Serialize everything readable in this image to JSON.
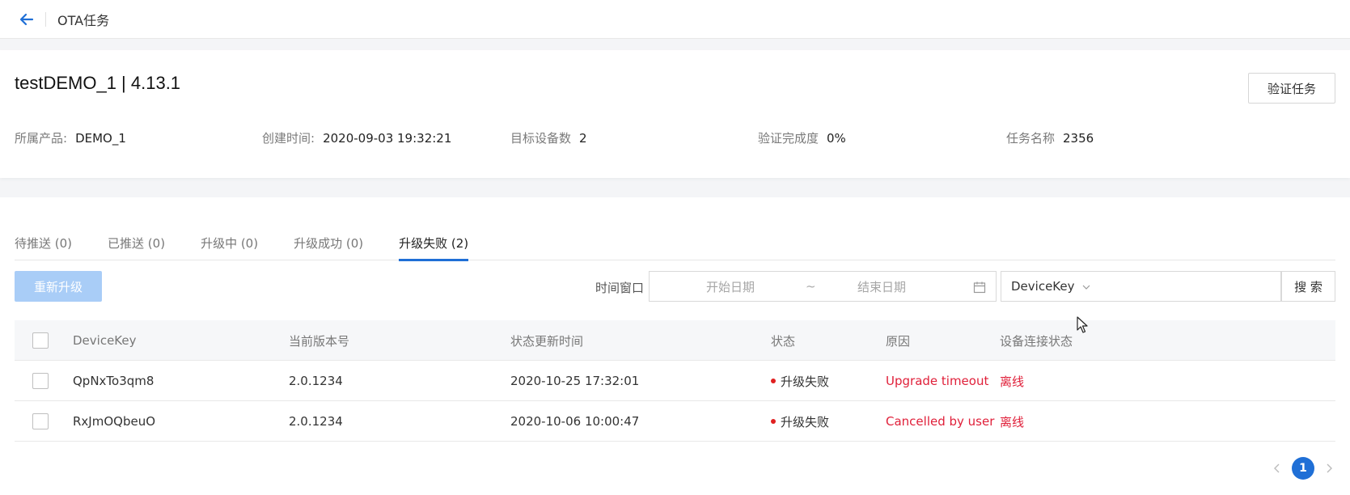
{
  "header": {
    "title": "OTA任务"
  },
  "task": {
    "title": "testDEMO_1 | 4.13.1",
    "verify_button": "验证任务",
    "meta": [
      {
        "label": "所属产品:",
        "value": "DEMO_1"
      },
      {
        "label": "创建时间:",
        "value": "2020-09-03 19:32:21"
      },
      {
        "label": "目标设备数",
        "value": "2"
      },
      {
        "label": "验证完成度",
        "value": "0%"
      },
      {
        "label": "任务名称",
        "value": "2356"
      }
    ]
  },
  "tabs": [
    {
      "label": "待推送 (0)",
      "active": false
    },
    {
      "label": "已推送 (0)",
      "active": false
    },
    {
      "label": "升级中 (0)",
      "active": false
    },
    {
      "label": "升级成功 (0)",
      "active": false
    },
    {
      "label": "升级失败 (2)",
      "active": true
    }
  ],
  "toolbar": {
    "reupgrade_label": "重新升级",
    "time_window_label": "时间窗口",
    "start_date_placeholder": "开始日期",
    "range_separator": "~",
    "end_date_placeholder": "结束日期",
    "search_field_selected": "DeviceKey",
    "search_input_value": "",
    "search_button": "搜 索"
  },
  "table": {
    "columns": [
      "DeviceKey",
      "当前版本号",
      "状态更新时间",
      "状态",
      "原因",
      "设备连接状态"
    ],
    "rows": [
      {
        "device_key": "QpNxTo3qm8",
        "version": "2.0.1234",
        "updated": "2020-10-25 17:32:01",
        "status": "升级失败",
        "reason": "Upgrade timeout",
        "connection": "离线"
      },
      {
        "device_key": "RxJmOQbeuO",
        "version": "2.0.1234",
        "updated": "2020-10-06 10:00:47",
        "status": "升级失败",
        "reason": "Cancelled by user",
        "connection": "离线"
      }
    ]
  },
  "pagination": {
    "current_page": "1"
  },
  "colors": {
    "accent": "#1f6fd6",
    "error": "#e0203a",
    "disabled_button": "#a9cdf7"
  },
  "icons": [
    "arrow-left-icon",
    "calendar-icon",
    "chevron-down-icon",
    "chevron-left-icon",
    "chevron-right-icon",
    "mouse-cursor-icon"
  ]
}
